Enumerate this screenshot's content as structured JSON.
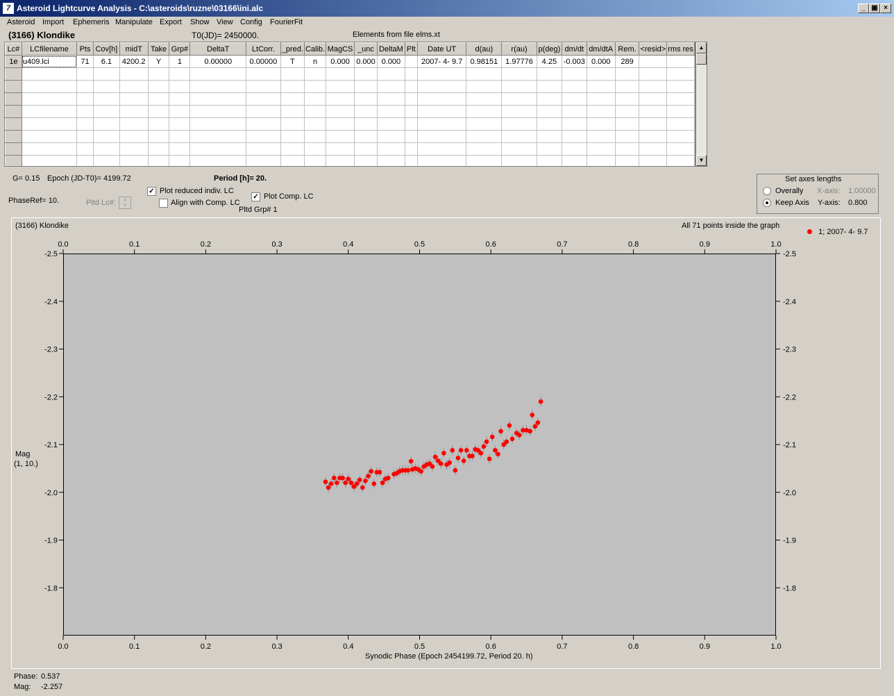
{
  "window": {
    "title": "Asteroid Lightcurve Analysis - C:\\asteroids\\ruzne\\03166\\ini.alc",
    "icon": "app-icon-7",
    "controls": [
      "_",
      "▣",
      "×"
    ]
  },
  "menu": [
    "Asteroid",
    "Import",
    "Ephemeris",
    "Manipulate",
    "Export",
    "Show",
    "View",
    "Config",
    "FourierFit"
  ],
  "header": {
    "asteroid_name": "(3166) Klondike",
    "t0": "T0(JD)= 2450000.",
    "elements": "Elements from file elms.xt"
  },
  "grid": {
    "columns": [
      "Lc#",
      "LCfilename",
      "Pts",
      "Cov[h]",
      "midT",
      "Take",
      "Grp#",
      "DeltaT",
      "LtCorr.",
      "_pred.",
      "Calib.",
      "MagCS",
      "_unc",
      "DeltaM",
      "Plt",
      "Date UT",
      "d(au)",
      "r(au)",
      "p(deg)",
      "dm/dt",
      "dm/dtA",
      "Rem.",
      "<resid>",
      "rms res"
    ],
    "rows": [
      [
        "1e",
        "u409.lci",
        "71",
        "6.1",
        "4200.2",
        "Y",
        "1",
        "0.00000",
        "0.00000",
        "T",
        "n",
        "0.000",
        "0.000",
        "0.000",
        "",
        "2007- 4- 9.7",
        "0.98151",
        "1.97776",
        "4.25",
        "-0.003",
        "0.000",
        "289",
        "",
        ""
      ]
    ],
    "empty_rows": 8
  },
  "info": {
    "g": "G= 0.15",
    "epoch": "Epoch (JD-T0)= 4199.72",
    "period": "Period [h]= 20.",
    "phaseref": "PhaseRef= 10.",
    "pltd_lc": "Pltd Lc#:",
    "plot_reduced": "Plot reduced indiv. LC",
    "align_comp": "Align with Comp. LC",
    "plot_comp": "Plot Comp. LC",
    "pltd_grp": "Pltd Grp#  1",
    "plot_reduced_checked": true,
    "align_comp_checked": false,
    "plot_comp_checked": true
  },
  "axes_group": {
    "title": "Set axes lengths",
    "overally": "Overally",
    "keep_axis": "Keep Axis",
    "x_label": "X-axis:",
    "x_value": "1.00000",
    "y_label": "Y-axis:",
    "y_value": "0.800",
    "selected": "Keep Axis"
  },
  "chart_data": {
    "type": "scatter",
    "title": "(3166) Klondike",
    "note": "All 71 points inside the graph",
    "legend": "1; 2007- 4- 9.7",
    "legend_color": "#ff0000",
    "xlabel": "Synodic Phase (Epoch 2454199.72, Period 20. h)",
    "ylabel_line1": "Mag",
    "ylabel_line2": "(1, 10.)",
    "xlim": [
      0.0,
      1.0
    ],
    "ylim": [
      -2.5,
      -1.7
    ],
    "y_inverted": true,
    "xticks": [
      "0.0",
      "0.1",
      "0.2",
      "0.3",
      "0.4",
      "0.5",
      "0.6",
      "0.7",
      "0.8",
      "0.9",
      "1.0"
    ],
    "yticks": [
      "-2.5",
      "-2.4",
      "-2.3",
      "-2.2",
      "-2.1",
      "-2.0",
      "-1.9",
      "-1.8"
    ],
    "points": [
      [
        0.368,
        -2.022
      ],
      [
        0.372,
        -2.01
      ],
      [
        0.376,
        -2.018
      ],
      [
        0.38,
        -2.03
      ],
      [
        0.384,
        -2.02
      ],
      [
        0.388,
        -2.03
      ],
      [
        0.392,
        -2.03
      ],
      [
        0.396,
        -2.02
      ],
      [
        0.4,
        -2.028
      ],
      [
        0.404,
        -2.02
      ],
      [
        0.408,
        -2.012
      ],
      [
        0.412,
        -2.018
      ],
      [
        0.416,
        -2.026
      ],
      [
        0.42,
        -2.01
      ],
      [
        0.424,
        -2.024
      ],
      [
        0.428,
        -2.034
      ],
      [
        0.432,
        -2.044
      ],
      [
        0.436,
        -2.018
      ],
      [
        0.44,
        -2.042
      ],
      [
        0.444,
        -2.042
      ],
      [
        0.448,
        -2.02
      ],
      [
        0.452,
        -2.028
      ],
      [
        0.456,
        -2.03
      ],
      [
        0.464,
        -2.038
      ],
      [
        0.468,
        -2.04
      ],
      [
        0.472,
        -2.044
      ],
      [
        0.476,
        -2.046
      ],
      [
        0.48,
        -2.046
      ],
      [
        0.484,
        -2.046
      ],
      [
        0.488,
        -2.065
      ],
      [
        0.49,
        -2.048
      ],
      [
        0.494,
        -2.05
      ],
      [
        0.498,
        -2.048
      ],
      [
        0.502,
        -2.044
      ],
      [
        0.506,
        -2.054
      ],
      [
        0.51,
        -2.058
      ],
      [
        0.514,
        -2.06
      ],
      [
        0.518,
        -2.054
      ],
      [
        0.522,
        -2.074
      ],
      [
        0.526,
        -2.066
      ],
      [
        0.53,
        -2.06
      ],
      [
        0.534,
        -2.082
      ],
      [
        0.538,
        -2.058
      ],
      [
        0.542,
        -2.062
      ],
      [
        0.546,
        -2.088
      ],
      [
        0.55,
        -2.046
      ],
      [
        0.554,
        -2.072
      ],
      [
        0.558,
        -2.088
      ],
      [
        0.562,
        -2.066
      ],
      [
        0.566,
        -2.088
      ],
      [
        0.57,
        -2.076
      ],
      [
        0.574,
        -2.076
      ],
      [
        0.578,
        -2.09
      ],
      [
        0.582,
        -2.088
      ],
      [
        0.586,
        -2.082
      ],
      [
        0.59,
        -2.096
      ],
      [
        0.594,
        -2.106
      ],
      [
        0.598,
        -2.07
      ],
      [
        0.602,
        -2.116
      ],
      [
        0.606,
        -2.088
      ],
      [
        0.61,
        -2.08
      ],
      [
        0.614,
        -2.128
      ],
      [
        0.618,
        -2.1
      ],
      [
        0.622,
        -2.106
      ],
      [
        0.626,
        -2.14
      ],
      [
        0.63,
        -2.112
      ],
      [
        0.636,
        -2.124
      ],
      [
        0.64,
        -2.12
      ],
      [
        0.645,
        -2.13
      ],
      [
        0.65,
        -2.13
      ],
      [
        0.655,
        -2.128
      ],
      [
        0.658,
        -2.162
      ],
      [
        0.662,
        -2.138
      ],
      [
        0.666,
        -2.146
      ],
      [
        0.67,
        -2.19
      ]
    ]
  },
  "status": {
    "phase_label": "Phase:",
    "phase_value": "0.537",
    "mag_label": "Mag:",
    "mag_value": "-2.257"
  }
}
